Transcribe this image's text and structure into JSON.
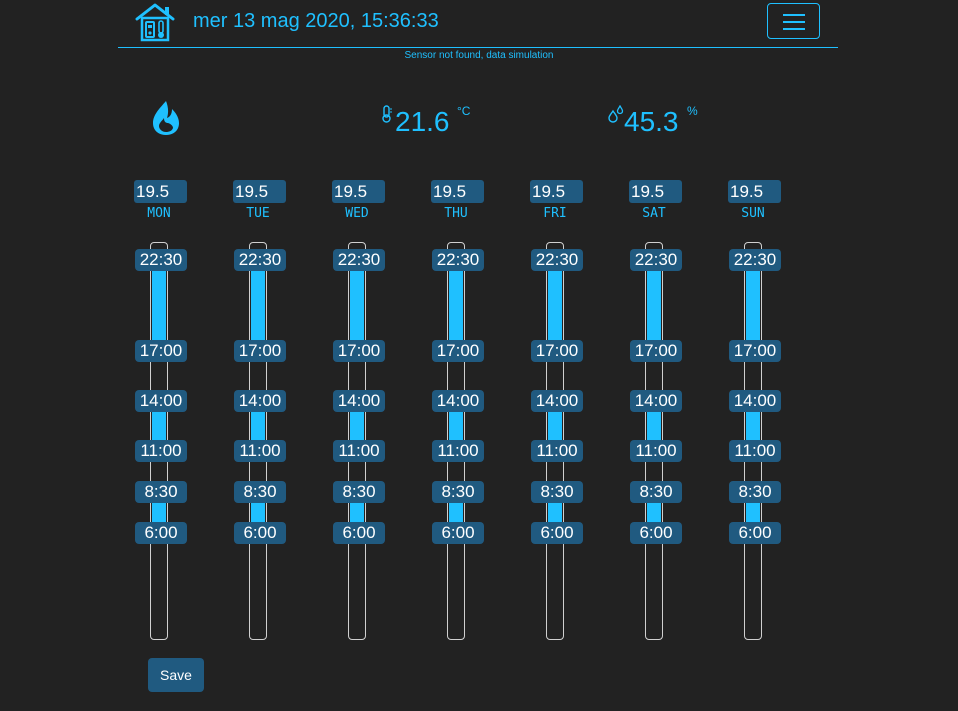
{
  "header": {
    "datetime": "mer 13 mag 2020, 15:36:33",
    "logo_icon": "house-thermostat-icon",
    "menu_icon": "hamburger-menu-icon"
  },
  "sensor_note": "Sensor not found, data simulation",
  "status": {
    "heating_icon": "flame-icon",
    "temperature": {
      "icon": "thermometer-icon",
      "value": "21.6",
      "unit": "°C"
    },
    "humidity": {
      "icon": "water-drops-icon",
      "value": "45.3",
      "unit": "%"
    }
  },
  "colors": {
    "accent": "#1fc0ff",
    "background": "#222222",
    "control": "#205a80"
  },
  "schedule": {
    "days": [
      {
        "name": "MON",
        "setpoint": "19.5",
        "times": [
          "22:30",
          "17:00",
          "14:00",
          "11:00",
          "8:30",
          "6:00"
        ]
      },
      {
        "name": "TUE",
        "setpoint": "19.5",
        "times": [
          "22:30",
          "17:00",
          "14:00",
          "11:00",
          "8:30",
          "6:00"
        ]
      },
      {
        "name": "WED",
        "setpoint": "19.5",
        "times": [
          "22:30",
          "17:00",
          "14:00",
          "11:00",
          "8:30",
          "6:00"
        ]
      },
      {
        "name": "THU",
        "setpoint": "19.5",
        "times": [
          "22:30",
          "17:00",
          "14:00",
          "11:00",
          "8:30",
          "6:00"
        ]
      },
      {
        "name": "FRI",
        "setpoint": "19.5",
        "times": [
          "22:30",
          "17:00",
          "14:00",
          "11:00",
          "8:30",
          "6:00"
        ]
      },
      {
        "name": "SAT",
        "setpoint": "19.5",
        "times": [
          "22:30",
          "17:00",
          "14:00",
          "11:00",
          "8:30",
          "6:00"
        ]
      },
      {
        "name": "SUN",
        "setpoint": "19.5",
        "times": [
          "22:30",
          "17:00",
          "14:00",
          "11:00",
          "8:30",
          "6:00"
        ]
      }
    ]
  },
  "save_label": "Save"
}
